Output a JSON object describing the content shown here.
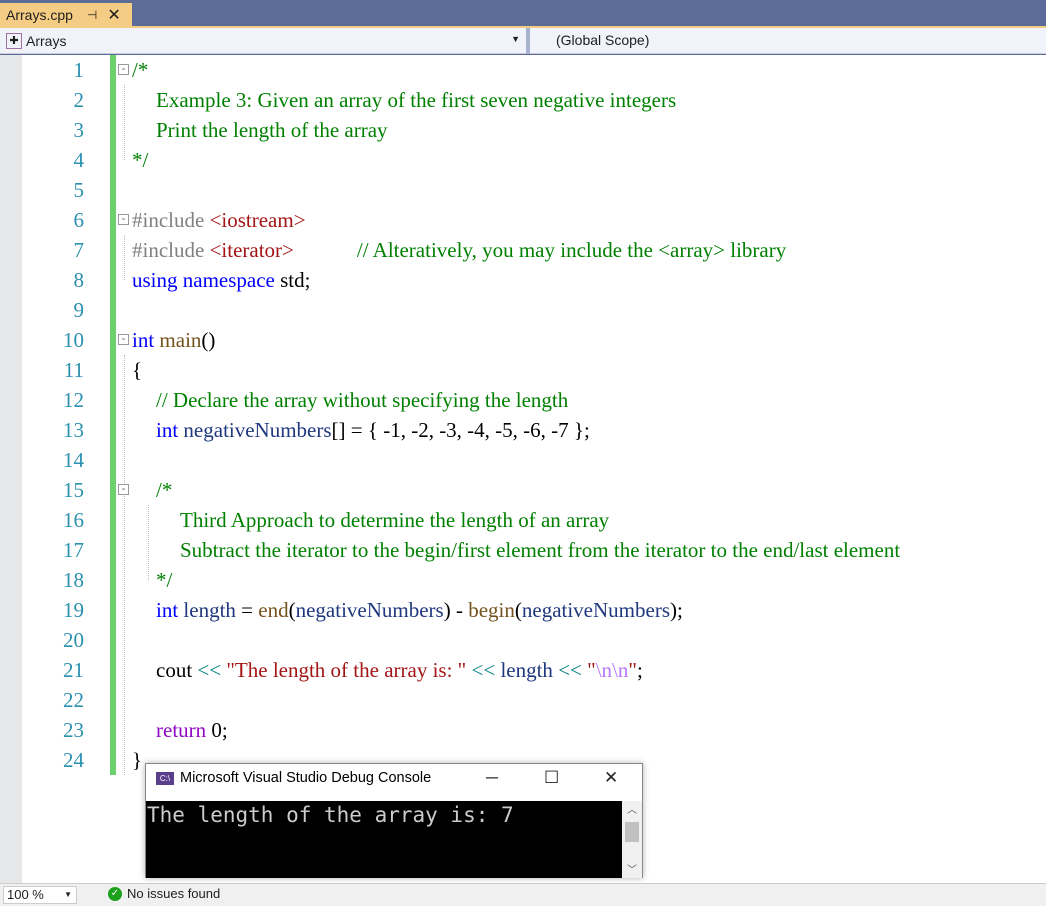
{
  "tab": {
    "title": "Arrays.cpp",
    "pin_icon": "pin-icon",
    "close_icon": "close-icon"
  },
  "nav": {
    "project": "Arrays",
    "scope": "(Global Scope)"
  },
  "lines": [
    {
      "n": "1",
      "fold": "-",
      "indent": 0,
      "tokens": [
        [
          "/*",
          "com"
        ]
      ]
    },
    {
      "n": "2",
      "indent": 1,
      "tokens": [
        [
          "Example 3: Given an array of the first seven negative integers",
          "com"
        ]
      ]
    },
    {
      "n": "3",
      "indent": 1,
      "tokens": [
        [
          "Print the length of the array",
          "com"
        ]
      ]
    },
    {
      "n": "4",
      "indent": 0,
      "tokens": [
        [
          "*/",
          "com"
        ]
      ]
    },
    {
      "n": "5",
      "indent": 0,
      "tokens": []
    },
    {
      "n": "6",
      "fold": "-",
      "indent": 0,
      "tokens": [
        [
          "#include ",
          "pp"
        ],
        [
          "<iostream>",
          "str"
        ]
      ]
    },
    {
      "n": "7",
      "indent": 0,
      "tokens": [
        [
          "#include ",
          "pp"
        ],
        [
          "<iterator>",
          "str"
        ],
        [
          "            ",
          "txt"
        ],
        [
          "// Alteratively, you may include the <array> library",
          "com"
        ]
      ]
    },
    {
      "n": "8",
      "indent": 0,
      "tokens": [
        [
          "using namespace ",
          "kw"
        ],
        [
          "std;",
          "txt"
        ]
      ]
    },
    {
      "n": "9",
      "indent": 0,
      "tokens": []
    },
    {
      "n": "10",
      "fold": "-",
      "indent": 0,
      "tokens": [
        [
          "int ",
          "kw"
        ],
        [
          "main",
          "fn"
        ],
        [
          "()",
          "txt"
        ]
      ]
    },
    {
      "n": "11",
      "indent": 0,
      "tokens": [
        [
          "{",
          "txt"
        ]
      ]
    },
    {
      "n": "12",
      "indent": 1,
      "tokens": [
        [
          "// Declare the array without specifying the length",
          "com"
        ]
      ]
    },
    {
      "n": "13",
      "indent": 1,
      "tokens": [
        [
          "int ",
          "kw"
        ],
        [
          "negativeNumbers",
          "var"
        ],
        [
          "[] = { -1, -2, -3, -4, -5, -6, -7 };",
          "txt"
        ]
      ]
    },
    {
      "n": "14",
      "indent": 0,
      "tokens": []
    },
    {
      "n": "15",
      "fold": "-",
      "indent": 1,
      "tokens": [
        [
          "/*",
          "com"
        ]
      ]
    },
    {
      "n": "16",
      "indent": 2,
      "tokens": [
        [
          "Third Approach to determine the length of an array",
          "com"
        ]
      ]
    },
    {
      "n": "17",
      "indent": 2,
      "tokens": [
        [
          "Subtract the iterator to the begin/first element from the iterator to the end/last element",
          "com"
        ]
      ]
    },
    {
      "n": "18",
      "indent": 1,
      "tokens": [
        [
          "*/",
          "com"
        ]
      ]
    },
    {
      "n": "19",
      "indent": 1,
      "tokens": [
        [
          "int ",
          "kw"
        ],
        [
          "length",
          "var"
        ],
        [
          " = ",
          "txt"
        ],
        [
          "end",
          "fn"
        ],
        [
          "(",
          "txt"
        ],
        [
          "negativeNumbers",
          "var"
        ],
        [
          ") - ",
          "txt"
        ],
        [
          "begin",
          "fn"
        ],
        [
          "(",
          "txt"
        ],
        [
          "negativeNumbers",
          "var"
        ],
        [
          ");",
          "txt"
        ]
      ]
    },
    {
      "n": "20",
      "indent": 0,
      "tokens": []
    },
    {
      "n": "21",
      "indent": 1,
      "tokens": [
        [
          "cout ",
          "txt"
        ],
        [
          "<< ",
          "op"
        ],
        [
          "\"The length of the array is: \" ",
          "str"
        ],
        [
          "<< ",
          "op"
        ],
        [
          "length ",
          "var"
        ],
        [
          "<< ",
          "op"
        ],
        [
          "\"",
          "str"
        ],
        [
          "\\n\\n",
          "esc"
        ],
        [
          "\"",
          "str"
        ],
        [
          ";",
          "txt"
        ]
      ]
    },
    {
      "n": "22",
      "indent": 0,
      "tokens": []
    },
    {
      "n": "23",
      "indent": 1,
      "tokens": [
        [
          "return ",
          "ret"
        ],
        [
          "0;",
          "txt"
        ]
      ]
    },
    {
      "n": "24",
      "indent": 0,
      "tokens": [
        [
          "}",
          "txt"
        ]
      ]
    }
  ],
  "console": {
    "title": "Microsoft Visual Studio Debug Console",
    "icon": "console-app-icon",
    "output": "The length of the array is: 7",
    "minimize": "─",
    "maximize": "☐",
    "close": "✕"
  },
  "status": {
    "zoom": "100 %",
    "issues": "No issues found"
  }
}
